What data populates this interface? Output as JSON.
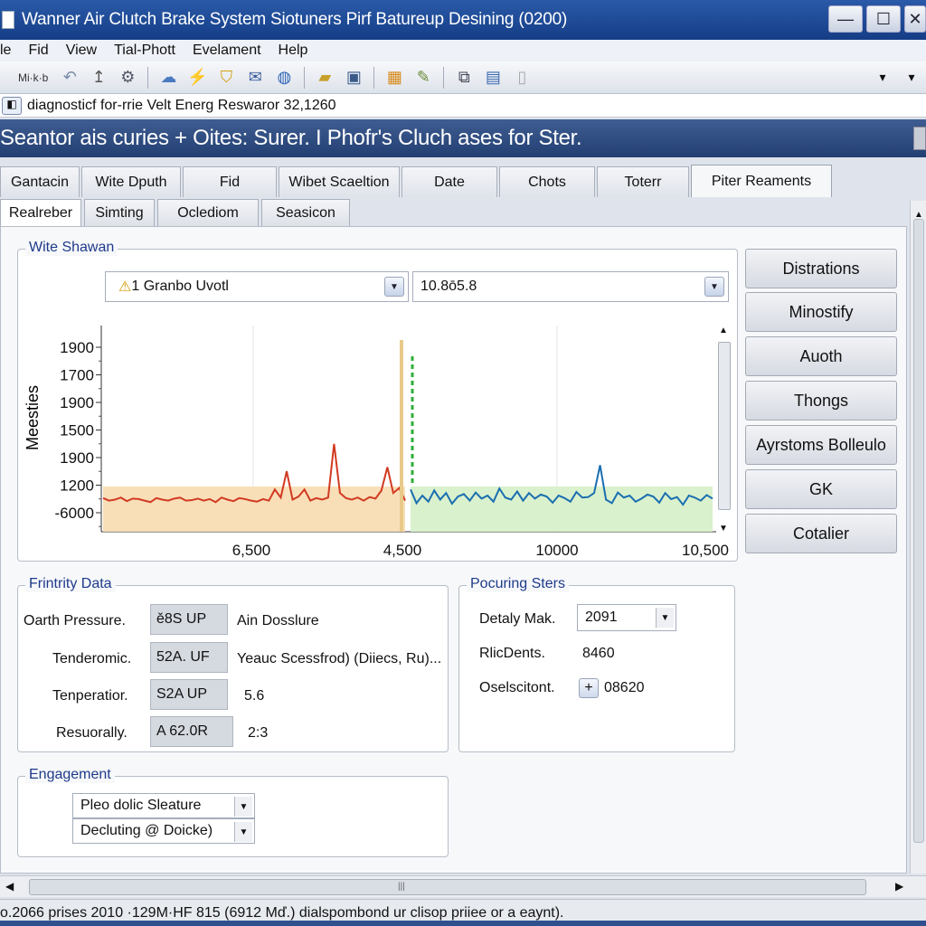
{
  "window": {
    "title": "Wanner Air Clutch Brake System Siotuners Pirf Batureup Desining (0200)",
    "min_symbol": "—",
    "max_symbol": "☐",
    "close_symbol": "✕"
  },
  "menu": [
    "le",
    "Fid",
    "View",
    "Tial-Phott",
    "Evelament",
    "Help"
  ],
  "toolbar": {
    "text": "Mi·k·b",
    "icons": [
      "home-icon",
      "undo-icon",
      "up-arrow-icon",
      "settings-icon",
      "cloud-icon",
      "connect-icon",
      "shield-icon",
      "mail-icon",
      "globe-icon",
      "folder-icon",
      "save-icon",
      "chart-icon",
      "wrench-icon",
      "copy-icon",
      "paste-icon",
      "page-icon"
    ],
    "dropdown_arrows": [
      "▾",
      "▾"
    ]
  },
  "address": {
    "value": "diagnosticf for-rrie Velt Energ Reswaror 32,1260"
  },
  "banner": {
    "text": "Seantor ais curies + Oites: Surer. I Phofr's Cluch ases for Ster."
  },
  "tabs": [
    "Gantacin",
    "Wite Dputh",
    "Fid",
    "Wibet Scaeltion",
    "Date",
    "Chots",
    "Toterr",
    "Piter Reaments"
  ],
  "active_tab": "Piter Reaments",
  "subtabs": [
    "Realreber",
    "Simting",
    "Oclediom",
    "Seasicon"
  ],
  "active_subtab": "Realreber",
  "chart_group": {
    "legend": "Wite Shawan",
    "combo_left": {
      "icon": "⚠",
      "value": "1 Granbo Uvotl"
    },
    "combo_right": {
      "value": "10.8ō5.8"
    }
  },
  "chart_data": {
    "type": "line",
    "ylabel": "Meesties",
    "ytick_labels": [
      "1900",
      "1700",
      "1900",
      "1500",
      "1900",
      "1200",
      "-6000"
    ],
    "xtick_labels": [
      "6,500",
      "4,500",
      "10000",
      "10,500"
    ],
    "series": [
      {
        "color": "#d23a22",
        "fill": "#f7dcb0",
        "values": [
          1195,
          1190,
          1192,
          1196,
          1189,
          1194,
          1193,
          1190,
          1187,
          1195,
          1192,
          1190,
          1194,
          1196,
          1190,
          1191,
          1194,
          1190,
          1193,
          1187,
          1196,
          1192,
          1189,
          1195,
          1193,
          1190,
          1188,
          1193,
          1190,
          1212,
          1196,
          1248,
          1192,
          1198,
          1212,
          1190,
          1195,
          1192,
          1196,
          1302,
          1205,
          1195,
          1192,
          1196,
          1190,
          1197,
          1194,
          1210,
          1256,
          1205,
          1215,
          1190
        ]
      },
      {
        "color": "#1a6fb0",
        "fill": "#d6efc8",
        "values": [
          1212,
          1185,
          1200,
          1188,
          1210,
          1192,
          1205,
          1184,
          1198,
          1203,
          1190,
          1206,
          1194,
          1200,
          1188,
          1214,
          1196,
          1192,
          1208,
          1190,
          1205,
          1194,
          1202,
          1198,
          1186,
          1200,
          1195,
          1188,
          1207,
          1196,
          1197,
          1205,
          1260,
          1192,
          1185,
          1206,
          1196,
          1200,
          1188,
          1194,
          1202,
          1198,
          1186,
          1205,
          1193,
          1197,
          1182,
          1200,
          1196,
          1190,
          1201,
          1194
        ]
      }
    ],
    "marker_lines": [
      {
        "color": "#e8c98a",
        "style": "solid"
      },
      {
        "color": "#2fae3a",
        "style": "dashed"
      }
    ]
  },
  "side_buttons": [
    "Distrations",
    "Minostify",
    "Auoth",
    "Thongs",
    "Ayrstoms Bolleulo",
    "GK",
    "Cotalier"
  ],
  "frintrity": {
    "legend": "Frintrity Data",
    "rows": [
      {
        "label": "Oarth Pressure.",
        "value": "ě8S UP",
        "extra": "Ain Dosslure"
      },
      {
        "label": "Tenderomic.",
        "value": "52A. UF",
        "extra": "Yeauc Scessfrod) (Diiecs, Ru)..."
      },
      {
        "label": "Tenperatior.",
        "value": "S2A UP",
        "extra": "5.6"
      },
      {
        "label": "Resuorally.",
        "value": "A 62.0R",
        "extra": "2:3"
      }
    ]
  },
  "pocuring": {
    "legend": "Pocuring Sters",
    "rows": [
      {
        "label": "Detaly Mak.",
        "value": "2091"
      },
      {
        "label": "RlicDents.",
        "value": "8460"
      },
      {
        "label": "Oselscitont.",
        "value": "08620"
      }
    ]
  },
  "engagement": {
    "legend": "Engagement",
    "options": [
      "Pleo dolic Sleature",
      "Decluting @ Doicke)"
    ]
  },
  "hscroll": {
    "grip": "|||"
  },
  "status": {
    "text": "o.2066 prises 2010 ·129M·HF 815 (6912 Mď.) dialspombond ur clisop priiee or a eaynt)."
  }
}
